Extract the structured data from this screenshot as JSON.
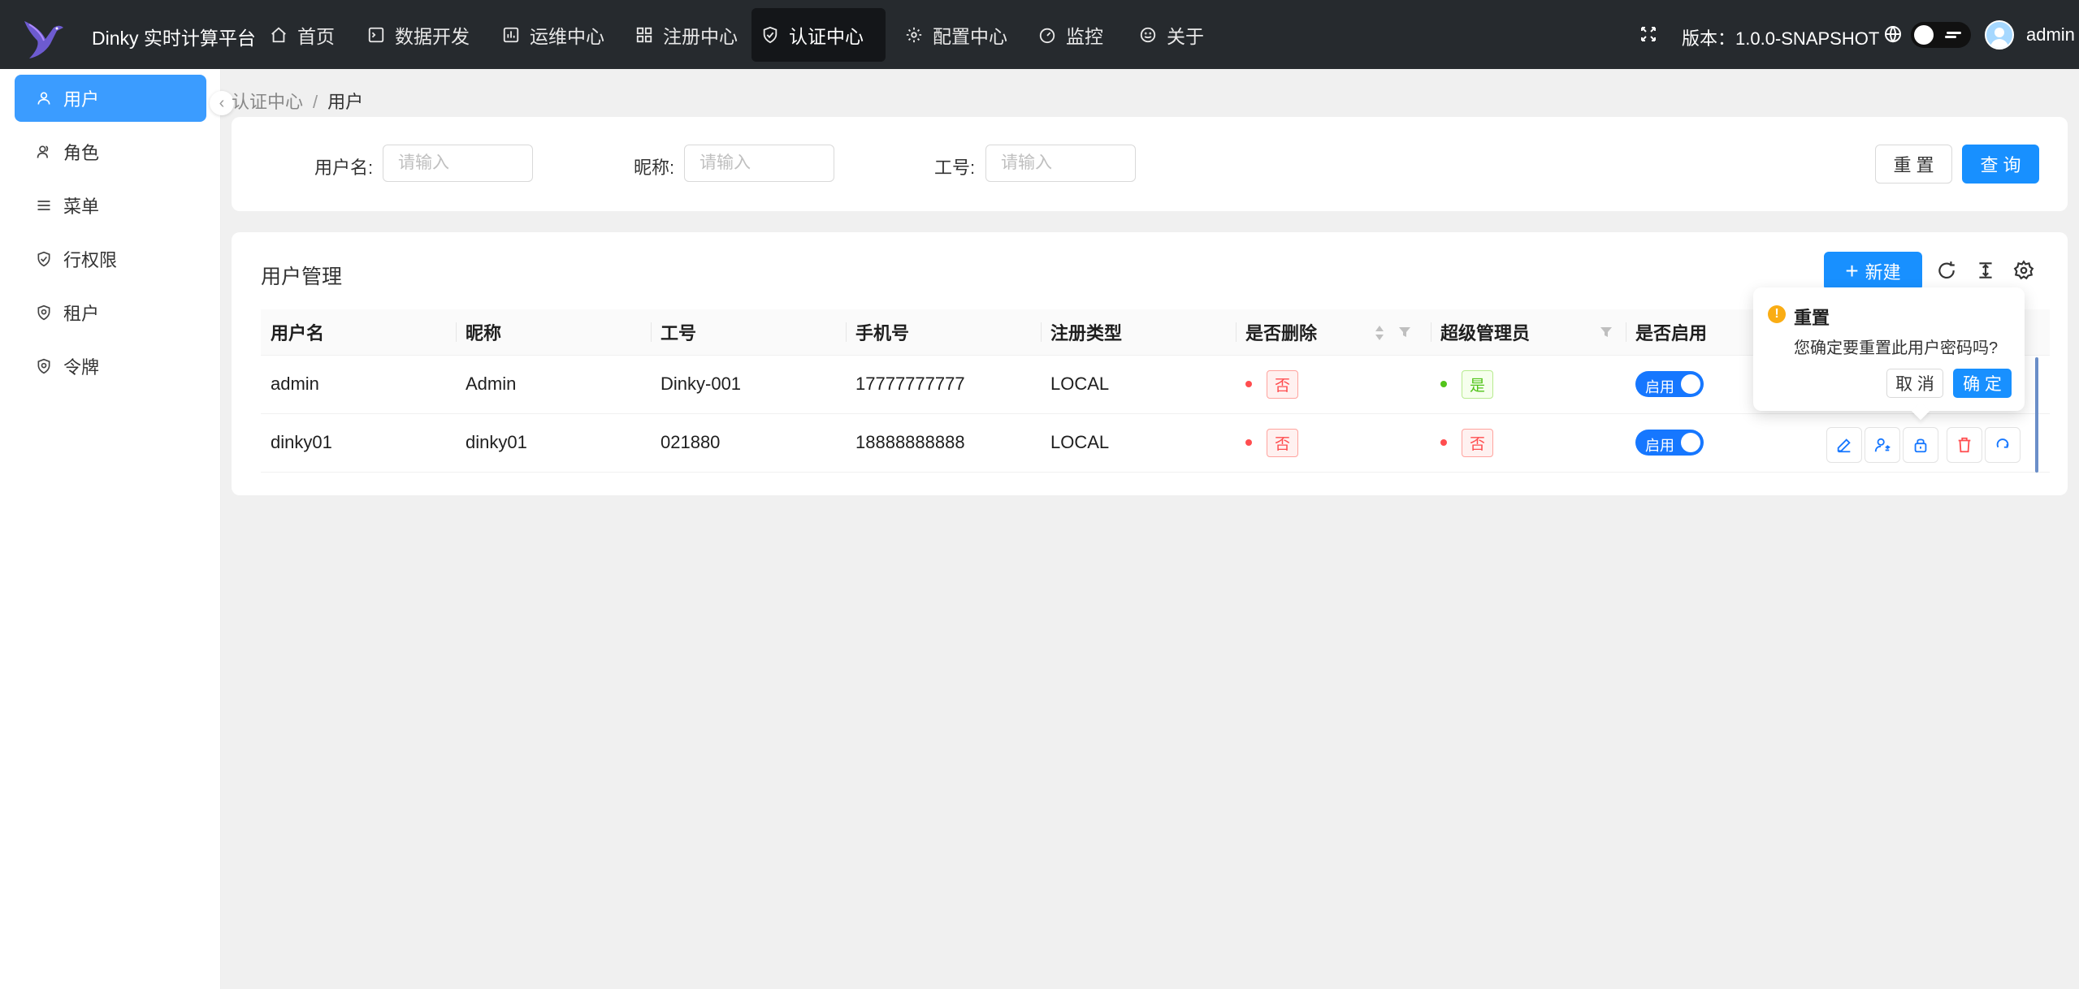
{
  "header": {
    "app_title": "Dinky 实时计算平台",
    "nav": [
      {
        "label": "首页",
        "icon": "home-icon"
      },
      {
        "label": "数据开发",
        "icon": "terminal-icon"
      },
      {
        "label": "运维中心",
        "icon": "dashboard-chart-icon"
      },
      {
        "label": "注册中心",
        "icon": "grid-icon"
      },
      {
        "label": "认证中心",
        "icon": "shield-check-icon",
        "active": true
      },
      {
        "label": "配置中心",
        "icon": "gear-icon"
      },
      {
        "label": "监控",
        "icon": "gauge-icon"
      },
      {
        "label": "关于",
        "icon": "smile-icon"
      }
    ],
    "version": "版本：1.0.0-SNAPSHOT",
    "username": "admin"
  },
  "sidebar": {
    "items": [
      {
        "label": "用户",
        "icon": "user-icon",
        "active": true
      },
      {
        "label": "角色",
        "icon": "team-icon"
      },
      {
        "label": "菜单",
        "icon": "menu-icon"
      },
      {
        "label": "行权限",
        "icon": "shield-check-icon"
      },
      {
        "label": "租户",
        "icon": "shield-icon"
      },
      {
        "label": "令牌",
        "icon": "shield-icon"
      }
    ]
  },
  "breadcrumb": {
    "parent": "认证中心",
    "separator": "/",
    "current": "用户"
  },
  "search": {
    "fields": [
      {
        "label": "用户名:",
        "placeholder": "请输入"
      },
      {
        "label": "昵称:",
        "placeholder": "请输入"
      },
      {
        "label": "工号:",
        "placeholder": "请输入"
      }
    ],
    "reset_label": "重 置",
    "query_label": "查 询"
  },
  "table": {
    "title": "用户管理",
    "new_label": "新建",
    "columns": [
      "用户名",
      "昵称",
      "工号",
      "手机号",
      "注册类型",
      "是否删除",
      "超级管理员",
      "是否启用"
    ],
    "rows": [
      {
        "username": "admin",
        "nickname": "Admin",
        "worknum": "Dinky-001",
        "mobile": "17777777777",
        "type": "LOCAL",
        "deleted": "否",
        "super": "是",
        "enabled": "启用"
      },
      {
        "username": "dinky01",
        "nickname": "dinky01",
        "worknum": "021880",
        "mobile": "18888888888",
        "type": "LOCAL",
        "deleted": "否",
        "super": "否",
        "enabled": "启用"
      }
    ]
  },
  "popconfirm": {
    "title": "重置",
    "description": "您确定要重置此用户密码吗?",
    "cancel_label": "取 消",
    "ok_label": "确 定"
  },
  "colors": {
    "primary": "#1890ff",
    "header_bg": "#262a2e",
    "danger": "#ff4d4f",
    "success": "#52c41a",
    "warning": "#faad14"
  }
}
